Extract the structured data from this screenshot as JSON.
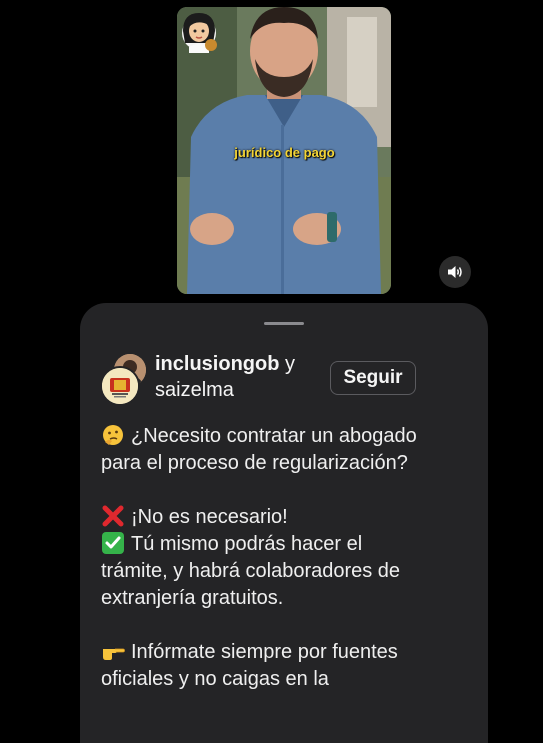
{
  "video": {
    "caption_overlay": "jurídico de pago",
    "sticker_icon": "woman-with-money-bag-emoji",
    "mute_icon": "speaker-icon"
  },
  "sheet": {
    "author_primary": "inclusiongob",
    "author_connector": " y",
    "author_secondary": "saizelma",
    "follow_label": "Seguir",
    "caption": [
      {
        "emoji": "thinking-face-emoji",
        "lines": [
          "¿Necesito contratar un abogado",
          "para el proceso de regularización?"
        ]
      },
      {
        "emoji": "cross-mark-emoji",
        "lines": [
          "¡No es necesario!"
        ]
      },
      {
        "emoji": "check-mark-emoji",
        "lines": [
          "Tú mismo podrás hacer el",
          "trámite, y habrá colaboradores de",
          "extranjería gratuitos."
        ]
      },
      {
        "emoji": "pointing-hand-emoji",
        "lines": [
          "Infórmate siempre por fuentes",
          "oficiales y no caigas en la"
        ]
      }
    ]
  },
  "colors": {
    "background": "#000000",
    "sheet": "#242426",
    "caption_overlay": "#f4d535",
    "cross": "#e0282e",
    "check": "#35b34a"
  }
}
